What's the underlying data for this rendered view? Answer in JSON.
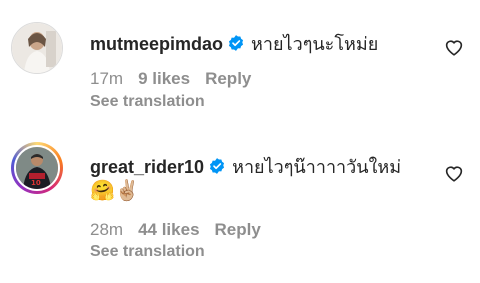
{
  "comments": [
    {
      "username": "mutmeepimdao",
      "verified": true,
      "text": "หายไวๆนะโหม่ย",
      "time": "17m",
      "likes": "9 likes",
      "reply": "Reply",
      "see_translation": "See translation"
    },
    {
      "username": "great_rider10",
      "verified": true,
      "text": "หายไวๆน๊าาาาวันใหม่",
      "emoji": "🤗✌🏼",
      "time": "28m",
      "likes": "44 likes",
      "reply": "Reply",
      "see_translation": "See translation"
    }
  ],
  "icons": {
    "verified": "verified-badge-icon",
    "like": "heart-outline-icon"
  },
  "colors": {
    "verified_blue": "#0095f6",
    "meta_gray": "#8e8e8e",
    "text": "#262626"
  }
}
